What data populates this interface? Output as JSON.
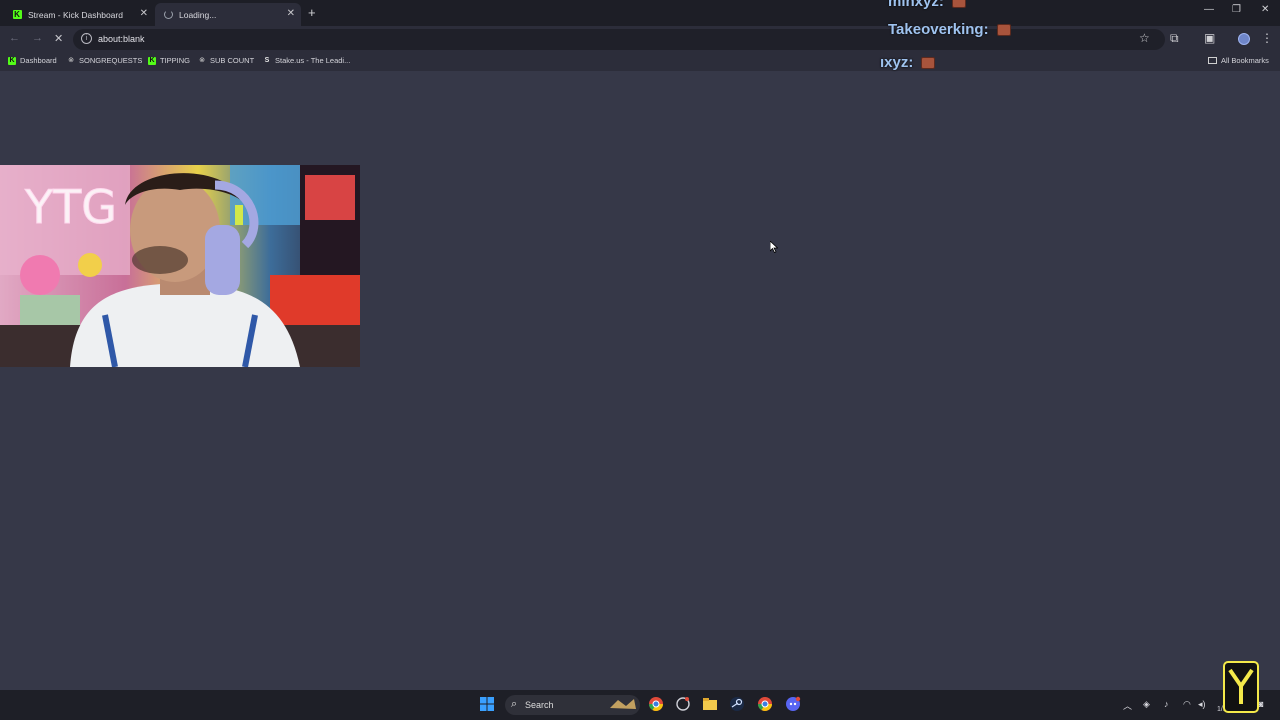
{
  "browser": {
    "tabs": [
      {
        "title": "Stream - Kick Dashboard",
        "state": "inactive"
      },
      {
        "title": "Loading...",
        "state": "active-loading"
      }
    ],
    "url": "about:blank",
    "bookmarks": [
      {
        "label": "Dashboard",
        "icon": "kick-icon"
      },
      {
        "label": "SONGREQUESTS",
        "icon": "streamelements-icon"
      },
      {
        "label": "TIPPING",
        "icon": "kick-icon"
      },
      {
        "label": "SUB COUNT",
        "icon": "streamelements-icon"
      },
      {
        "label": "Stake.us - The Leadi...",
        "icon": "stake-icon"
      }
    ],
    "all_bookmarks_label": "All Bookmarks"
  },
  "chat_overlay": {
    "lines": [
      {
        "user": "minxyz:"
      },
      {
        "user": "Takeoverking:"
      },
      {
        "user": "ıxyz:"
      }
    ]
  },
  "webcam": {
    "neon_sign": "YTG"
  },
  "taskbar": {
    "search_label": "Search",
    "clock": "1/16"
  },
  "colors": {
    "page_bg": "#363848",
    "chat_name": "#9fc3ef",
    "kick_green": "#53fc18"
  }
}
